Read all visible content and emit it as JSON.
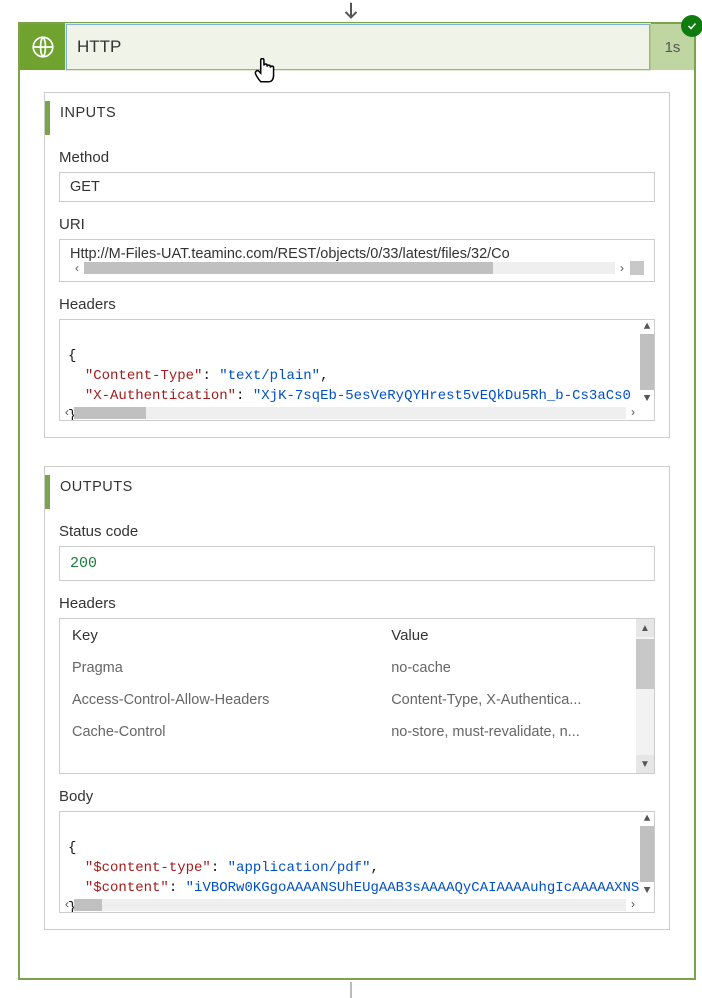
{
  "header": {
    "title": "HTTP",
    "duration": "1s"
  },
  "inputs": {
    "panel_title": "INPUTS",
    "method_label": "Method",
    "method_value": "GET",
    "uri_label": "URI",
    "uri_value": "Http://M-Files-UAT.teaminc.com/REST/objects/0/33/latest/files/32/Co",
    "headers_label": "Headers",
    "headers_json": {
      "open": "{",
      "k1": "\"Content-Type\"",
      "v1": "\"text/plain\"",
      "k2": "\"X-Authentication\"",
      "v2": "\"XjK-7sqEb-5esVeRyQYHrest5vEQkDu5Rh_b-Cs3aCs0",
      "close": "}"
    }
  },
  "outputs": {
    "panel_title": "OUTPUTS",
    "status_label": "Status code",
    "status_value": "200",
    "headers_label": "Headers",
    "table_key_header": "Key",
    "table_value_header": "Value",
    "rows": [
      {
        "k": "Pragma",
        "v": "no-cache"
      },
      {
        "k": "Access-Control-Allow-Headers",
        "v": "Content-Type, X-Authentica..."
      },
      {
        "k": "Cache-Control",
        "v": "no-store, must-revalidate, n..."
      }
    ],
    "body_label": "Body",
    "body_json": {
      "open": "{",
      "k1": "\"$content-type\"",
      "v1": "\"application/pdf\"",
      "k2": "\"$content\"",
      "v2": "\"iVBORw0KGgoAAAANSUhEUgAAB3sAAAAQyCAIAAAAuhgIcAAAAAXNS",
      "close": "}"
    }
  }
}
